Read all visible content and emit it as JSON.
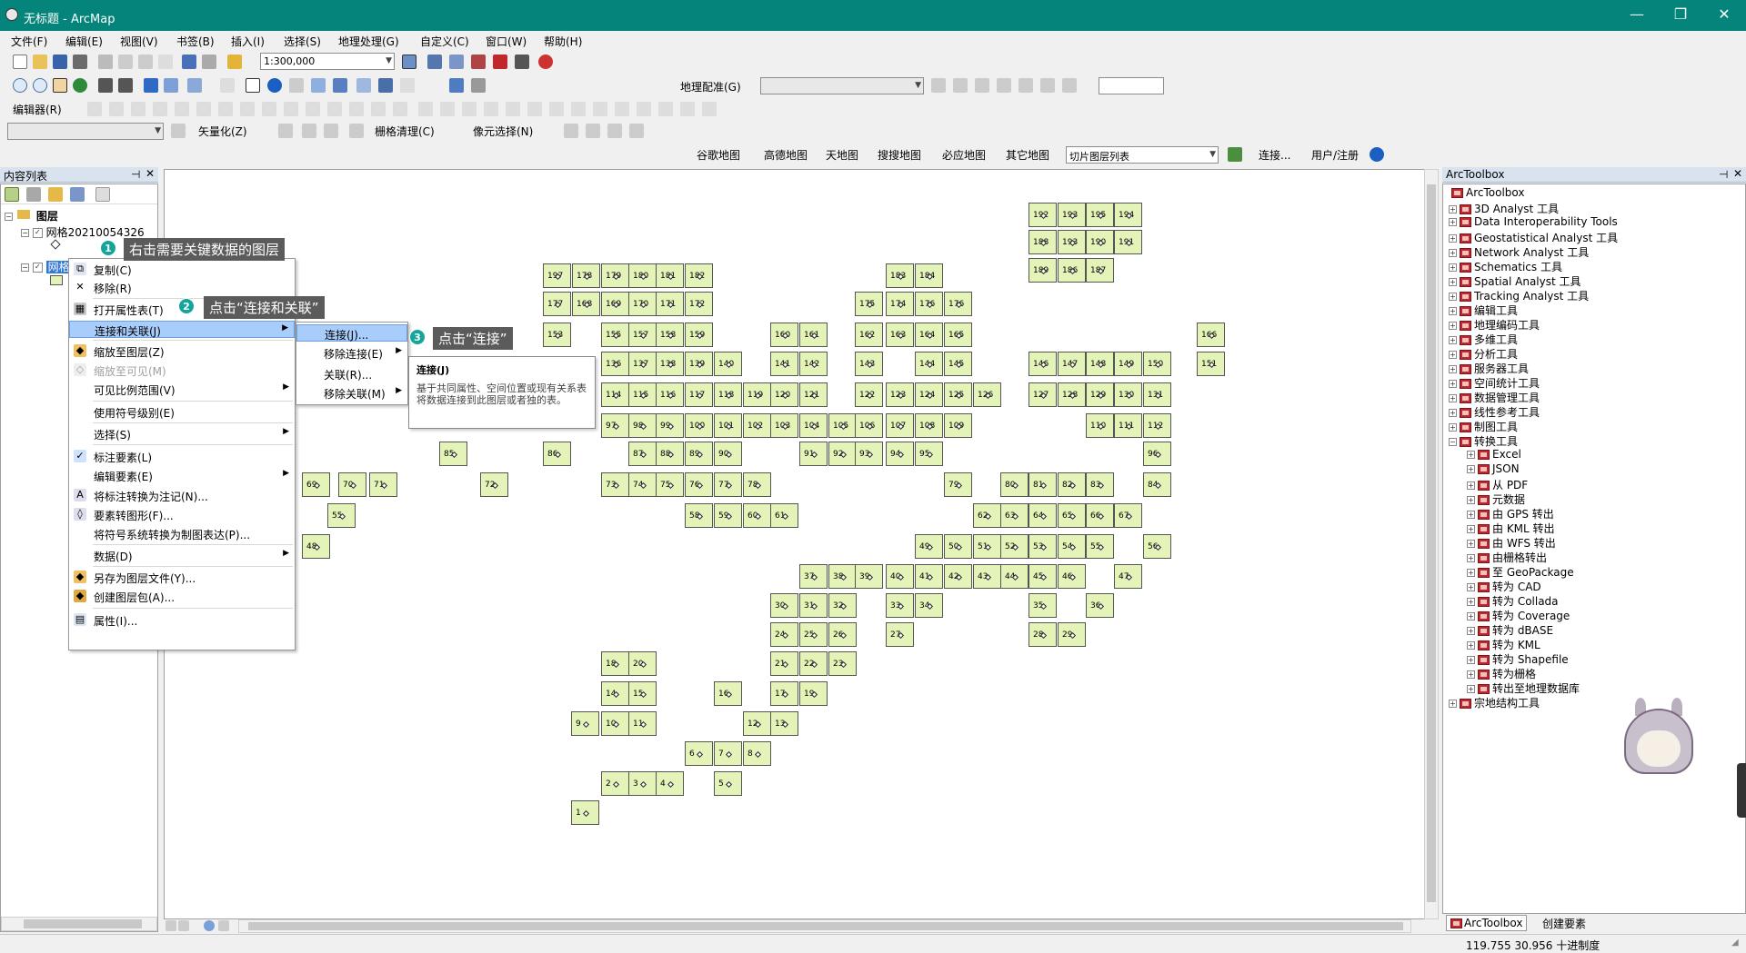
{
  "window": {
    "title": "无标题 - ArcMap",
    "min": "—",
    "max": "❐",
    "close": "✕"
  },
  "menu": [
    "文件(F)",
    "编辑(E)",
    "视图(V)",
    "书签(B)",
    "插入(I)",
    "选择(S)",
    "地理处理(G)",
    "自定义(C)",
    "窗口(W)",
    "帮助(H)"
  ],
  "toolbar": {
    "scale": "1:300,000",
    "georef_label": "地理配准(G)",
    "editor_label": "编辑器(R)",
    "vectorize_label": "矢量化(Z)",
    "raster_clean_label": "栅格清理(C)",
    "cell_select_label": "像元选择(N)",
    "basemaps": [
      "谷歌地图",
      "高德地图",
      "天地图",
      "搜搜地图",
      "必应地图",
      "其它地图",
      "切片图层列表"
    ],
    "connect_label": "连接...",
    "user_label": "用户/注册"
  },
  "toc": {
    "title": "内容列表",
    "layers_label": "图层",
    "layer1": "网格20210054326",
    "layer2": "网格"
  },
  "context_menu": {
    "items": [
      "复制(C)",
      "移除(R)",
      "打开属性表(T)",
      "连接和关联(J)",
      "缩放至图层(Z)",
      "缩放至可见(M)",
      "可见比例范围(V)",
      "使用符号级别(E)",
      "选择(S)",
      "标注要素(L)",
      "编辑要素(E)",
      "将标注转换为注记(N)...",
      "要素转图形(F)...",
      "将符号系统转换为制图表达(P)...",
      "数据(D)",
      "另存为图层文件(Y)...",
      "创建图层包(A)...",
      "属性(I)..."
    ]
  },
  "submenu": {
    "items": [
      "连接(J)...",
      "移除连接(E)",
      "关联(R)...",
      "移除关联(M)"
    ]
  },
  "tooltip": {
    "title": "连接(J)",
    "body": "基于共同属性、空间位置或现有关系表将数据连接到此图层或者独的表。"
  },
  "callouts": [
    {
      "n": "1",
      "text": "右击需要关键数据的图层"
    },
    {
      "n": "2",
      "text": "点击“连接和关联”"
    },
    {
      "n": "3",
      "text": "点击“连接”"
    }
  ],
  "toolbox": {
    "title": "ArcToolbox",
    "root": "ArcToolbox",
    "items": [
      "3D Analyst 工具",
      "Data Interoperability Tools",
      "Geostatistical Analyst 工具",
      "Network Analyst 工具",
      "Schematics 工具",
      "Spatial Analyst 工具",
      "Tracking Analyst 工具",
      "编辑工具",
      "地理编码工具",
      "多维工具",
      "分析工具",
      "服务器工具",
      "空间统计工具",
      "数据管理工具",
      "线性参考工具",
      "制图工具",
      "转换工具"
    ],
    "conversion_children": [
      "Excel",
      "JSON",
      "从 PDF",
      "元数据",
      "由 GPS 转出",
      "由 KML 转出",
      "由 WFS 转出",
      "由栅格转出",
      "至 GeoPackage",
      "转为 CAD",
      "转为 Collada",
      "转为 Coverage",
      "转为 dBASE",
      "转为 KML",
      "转为 Shapefile",
      "转为栅格",
      "转出至地理数据库"
    ],
    "last_item": "宗地结构工具",
    "tabs": [
      "ArcToolbox",
      "创建要素"
    ]
  },
  "status": {
    "coords": "119.755   30.956 十进制度"
  },
  "grid": [
    [
      1130,
      222,
      "192"
    ],
    [
      1162,
      222,
      "193"
    ],
    [
      1193,
      222,
      "195"
    ],
    [
      1224,
      222,
      "194"
    ],
    [
      1130,
      252,
      "188"
    ],
    [
      1162,
      252,
      "193"
    ],
    [
      1193,
      252,
      "190"
    ],
    [
      1224,
      252,
      "191"
    ],
    [
      1130,
      283,
      "189"
    ],
    [
      1162,
      283,
      "186"
    ],
    [
      1193,
      283,
      "187"
    ],
    [
      596,
      289,
      "197"
    ],
    [
      628,
      289,
      "178"
    ],
    [
      660,
      289,
      "179"
    ],
    [
      690,
      289,
      "180"
    ],
    [
      720,
      289,
      "181"
    ],
    [
      752,
      289,
      "182"
    ],
    [
      973,
      289,
      "183"
    ],
    [
      1005,
      289,
      "184"
    ],
    [
      596,
      320,
      "177"
    ],
    [
      628,
      320,
      "168"
    ],
    [
      660,
      320,
      "169"
    ],
    [
      690,
      320,
      "170"
    ],
    [
      720,
      320,
      "171"
    ],
    [
      752,
      320,
      "172"
    ],
    [
      939,
      320,
      "175"
    ],
    [
      973,
      320,
      "174"
    ],
    [
      1005,
      320,
      "176"
    ],
    [
      1037,
      320,
      "176"
    ],
    [
      596,
      354,
      "153"
    ],
    [
      660,
      354,
      "155"
    ],
    [
      690,
      354,
      "157"
    ],
    [
      720,
      354,
      "158"
    ],
    [
      752,
      354,
      "159"
    ],
    [
      846,
      354,
      "160"
    ],
    [
      878,
      354,
      "161"
    ],
    [
      939,
      354,
      "162"
    ],
    [
      973,
      354,
      "163"
    ],
    [
      1005,
      354,
      "164"
    ],
    [
      1037,
      354,
      "165"
    ],
    [
      1315,
      354,
      "166"
    ],
    [
      660,
      386,
      "136"
    ],
    [
      690,
      386,
      "137"
    ],
    [
      720,
      386,
      "138"
    ],
    [
      752,
      386,
      "139"
    ],
    [
      784,
      386,
      "140"
    ],
    [
      846,
      386,
      "141"
    ],
    [
      878,
      386,
      "142"
    ],
    [
      939,
      386,
      "143"
    ],
    [
      1005,
      386,
      "144"
    ],
    [
      1037,
      386,
      "145"
    ],
    [
      1130,
      386,
      "146"
    ],
    [
      1162,
      386,
      "147"
    ],
    [
      1193,
      386,
      "148"
    ],
    [
      1224,
      386,
      "149"
    ],
    [
      1256,
      386,
      "150"
    ],
    [
      1315,
      386,
      "151"
    ],
    [
      660,
      420,
      "114"
    ],
    [
      690,
      420,
      "115"
    ],
    [
      720,
      420,
      "116"
    ],
    [
      752,
      420,
      "117"
    ],
    [
      784,
      420,
      "118"
    ],
    [
      816,
      420,
      "119"
    ],
    [
      846,
      420,
      "120"
    ],
    [
      878,
      420,
      "121"
    ],
    [
      939,
      420,
      "122"
    ],
    [
      973,
      420,
      "123"
    ],
    [
      1005,
      420,
      "124"
    ],
    [
      1037,
      420,
      "125"
    ],
    [
      1069,
      420,
      "126"
    ],
    [
      1130,
      420,
      "127"
    ],
    [
      1162,
      420,
      "128"
    ],
    [
      1193,
      420,
      "129"
    ],
    [
      1224,
      420,
      "130"
    ],
    [
      1256,
      420,
      "131"
    ],
    [
      660,
      454,
      "97"
    ],
    [
      690,
      454,
      "98"
    ],
    [
      720,
      454,
      "99"
    ],
    [
      752,
      454,
      "100"
    ],
    [
      784,
      454,
      "101"
    ],
    [
      816,
      454,
      "102"
    ],
    [
      846,
      454,
      "103"
    ],
    [
      878,
      454,
      "104"
    ],
    [
      910,
      454,
      "105"
    ],
    [
      939,
      454,
      "106"
    ],
    [
      973,
      454,
      "107"
    ],
    [
      1005,
      454,
      "108"
    ],
    [
      1037,
      454,
      "109"
    ],
    [
      1193,
      454,
      "110"
    ],
    [
      1224,
      454,
      "111"
    ],
    [
      1256,
      454,
      "112"
    ],
    [
      482,
      485,
      "85"
    ],
    [
      596,
      485,
      "86"
    ],
    [
      690,
      485,
      "87"
    ],
    [
      720,
      485,
      "88"
    ],
    [
      752,
      485,
      "89"
    ],
    [
      784,
      485,
      "90"
    ],
    [
      878,
      485,
      "91"
    ],
    [
      910,
      485,
      "92"
    ],
    [
      939,
      485,
      "93"
    ],
    [
      973,
      485,
      "94"
    ],
    [
      1005,
      485,
      "95"
    ],
    [
      1256,
      485,
      "96"
    ],
    [
      331,
      519,
      "69"
    ],
    [
      371,
      519,
      "70"
    ],
    [
      405,
      519,
      "71"
    ],
    [
      527,
      519,
      "72"
    ],
    [
      660,
      519,
      "73"
    ],
    [
      690,
      519,
      "74"
    ],
    [
      720,
      519,
      "75"
    ],
    [
      752,
      519,
      "76"
    ],
    [
      784,
      519,
      "77"
    ],
    [
      816,
      519,
      "78"
    ],
    [
      1037,
      519,
      "79"
    ],
    [
      1099,
      519,
      "80"
    ],
    [
      1130,
      519,
      "81"
    ],
    [
      1162,
      519,
      "82"
    ],
    [
      1193,
      519,
      "83"
    ],
    [
      1256,
      519,
      "84"
    ],
    [
      359,
      553,
      "55"
    ],
    [
      752,
      553,
      "58"
    ],
    [
      784,
      553,
      "59"
    ],
    [
      816,
      553,
      "60"
    ],
    [
      846,
      553,
      "61"
    ],
    [
      1069,
      553,
      "62"
    ],
    [
      1099,
      553,
      "63"
    ],
    [
      1130,
      553,
      "64"
    ],
    [
      1162,
      553,
      "65"
    ],
    [
      1193,
      553,
      "66"
    ],
    [
      1224,
      553,
      "67"
    ],
    [
      331,
      587,
      "48"
    ],
    [
      1005,
      587,
      "49"
    ],
    [
      1037,
      587,
      "50"
    ],
    [
      1069,
      587,
      "51"
    ],
    [
      1099,
      587,
      "52"
    ],
    [
      1130,
      587,
      "53"
    ],
    [
      1162,
      587,
      "54"
    ],
    [
      1193,
      587,
      "55"
    ],
    [
      1256,
      587,
      "56"
    ],
    [
      878,
      620,
      "37"
    ],
    [
      910,
      620,
      "38"
    ],
    [
      939,
      620,
      "39"
    ],
    [
      973,
      620,
      "40"
    ],
    [
      1005,
      620,
      "41"
    ],
    [
      1037,
      620,
      "42"
    ],
    [
      1069,
      620,
      "43"
    ],
    [
      1099,
      620,
      "44"
    ],
    [
      1130,
      620,
      "45"
    ],
    [
      1162,
      620,
      "46"
    ],
    [
      1224,
      620,
      "47"
    ],
    [
      846,
      652,
      "30"
    ],
    [
      878,
      652,
      "31"
    ],
    [
      910,
      652,
      "32"
    ],
    [
      973,
      652,
      "33"
    ],
    [
      1005,
      652,
      "34"
    ],
    [
      1130,
      652,
      "35"
    ],
    [
      1193,
      652,
      "36"
    ],
    [
      846,
      684,
      "24"
    ],
    [
      878,
      684,
      "25"
    ],
    [
      910,
      684,
      "26"
    ],
    [
      973,
      684,
      "27"
    ],
    [
      1130,
      684,
      "28"
    ],
    [
      1162,
      684,
      "29"
    ],
    [
      846,
      716,
      "21"
    ],
    [
      878,
      716,
      "22"
    ],
    [
      910,
      716,
      "23"
    ],
    [
      660,
      716,
      "18"
    ],
    [
      690,
      716,
      "20"
    ],
    [
      660,
      749,
      "14"
    ],
    [
      690,
      749,
      "15"
    ],
    [
      784,
      749,
      "16"
    ],
    [
      846,
      749,
      "17"
    ],
    [
      878,
      749,
      "19"
    ],
    [
      627,
      782,
      "9"
    ],
    [
      660,
      782,
      "10"
    ],
    [
      690,
      782,
      "11"
    ],
    [
      816,
      782,
      "12"
    ],
    [
      846,
      782,
      "13"
    ],
    [
      752,
      815,
      "6"
    ],
    [
      784,
      815,
      "7"
    ],
    [
      816,
      815,
      "8"
    ],
    [
      660,
      848,
      "2"
    ],
    [
      690,
      848,
      "3"
    ],
    [
      720,
      848,
      "4"
    ],
    [
      784,
      848,
      "5"
    ],
    [
      627,
      880,
      "1"
    ]
  ]
}
